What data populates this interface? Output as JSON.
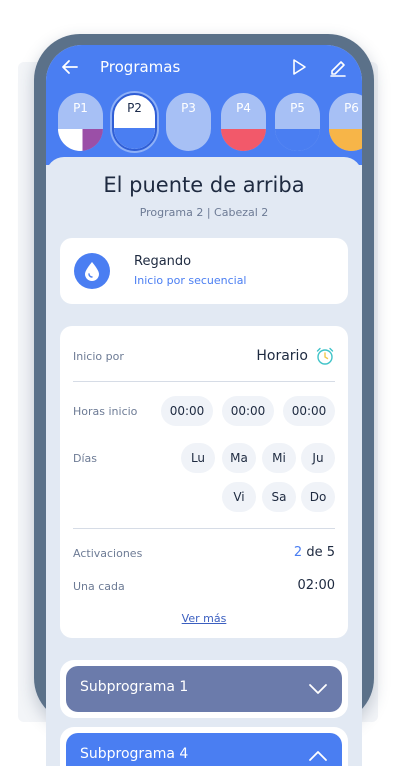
{
  "header": {
    "title": "Programas"
  },
  "programs": [
    {
      "label": "P1",
      "fill": "#9b4fa7"
    },
    {
      "label": "P2",
      "fill": "#4a7ef2",
      "active": true
    },
    {
      "label": "P3",
      "fill": ""
    },
    {
      "label": "P4",
      "fill": "#f2596a"
    },
    {
      "label": "P5",
      "fill": "#4a7ef2"
    },
    {
      "label": "P6",
      "fill": "#f7b548"
    }
  ],
  "program": {
    "name": "El puente de arriba",
    "subtitle": "Programa 2 | Cabezal 2"
  },
  "status": {
    "title": "Regando",
    "subtitle": "Inicio por secuencial"
  },
  "schedule": {
    "inicio_label": "Inicio por",
    "inicio_value": "Horario",
    "horas_label": "Horas inicio",
    "horas": [
      "00:00",
      "00:00",
      "00:00"
    ],
    "dias_label": "Días",
    "dias": [
      "Lu",
      "Ma",
      "Mi",
      "Ju",
      "Vi",
      "Sa",
      "Do"
    ],
    "activaciones_label": "Activaciones",
    "activaciones_current": "2",
    "activaciones_rest": " de 5",
    "una_cada_label": "Una cada",
    "una_cada_value": "02:00",
    "ver_mas": "Ver más"
  },
  "subprograms": [
    {
      "label": "Subprograma 1",
      "expanded": false
    },
    {
      "label": "Subprograma 4",
      "expanded": true
    }
  ],
  "colors": {
    "primary": "#4a7ef2",
    "subprogram_collapsed": "#6b7bab",
    "subprogram_expanded": "#4a7ef2"
  }
}
